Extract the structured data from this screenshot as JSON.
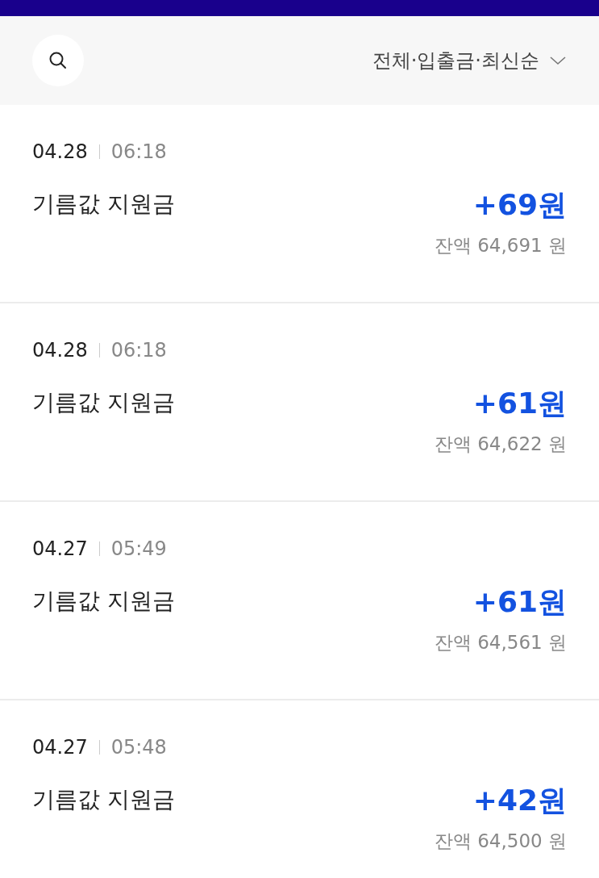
{
  "header": {
    "filter": "전체·입출금·최신순"
  },
  "transactions": [
    {
      "date": "04.28",
      "time": "06:18",
      "title": "기름값 지원금",
      "amount": "+69원",
      "balance": "잔액 64,691 원"
    },
    {
      "date": "04.28",
      "time": "06:18",
      "title": "기름값 지원금",
      "amount": "+61원",
      "balance": "잔액 64,622 원"
    },
    {
      "date": "04.27",
      "time": "05:49",
      "title": "기름값 지원금",
      "amount": "+61원",
      "balance": "잔액 64,561 원"
    },
    {
      "date": "04.27",
      "time": "05:48",
      "title": "기름값 지원금",
      "amount": "+42원",
      "balance": "잔액 64,500 원"
    }
  ]
}
